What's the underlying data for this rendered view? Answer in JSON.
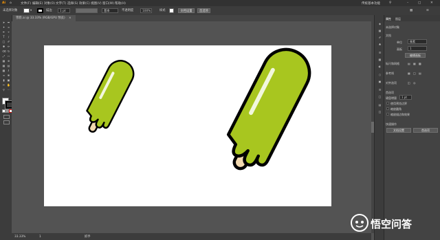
{
  "app": {
    "logo": "Ai",
    "home_icon": "home-icon",
    "accent": "#FF9A00",
    "window_title": "传统基本功能"
  },
  "menu": [
    "文件(F)",
    "编辑(E)",
    "对象(O)",
    "文字(T)",
    "选择(S)",
    "效果(C)",
    "视图(V)",
    "窗口(W)",
    "帮助(H)"
  ],
  "control": {
    "selection_label": "未选择对象",
    "stroke_value": "1 pt",
    "stroke_profile": "基本",
    "opacity_label": "不透明度",
    "opacity_value": "100%",
    "style_label": "样式",
    "doc_setup": "文档设置",
    "prefs": "首选项"
  },
  "document_tab": "雪糕.ai @ 33.33% (RGB/GPU 预览)",
  "status": {
    "zoom": "33.33%",
    "artboard": "1",
    "tool": "抓手"
  },
  "panel": {
    "tabs": [
      "属性",
      "图层"
    ],
    "section_doc": "未选择对象",
    "section_doc_label": "文档",
    "unit_label": "单位",
    "unit_value": "像素",
    "artboard_label": "画板",
    "artboard_value": "1",
    "edit_artboard": "编辑画板",
    "ruler_grid": "标尺和网格",
    "guides": "参考线",
    "align": "对齐选项",
    "prefs_header": "首选项",
    "keyboard_increment_label": "键盘增量",
    "keyboard_increment_value": "1 pt",
    "check1": "使用预览边界",
    "check2": "缩放圆角",
    "check3": "缩放描边和效果",
    "quick_actions": "快速操作",
    "btn_doc_setup": "文档设置",
    "btn_prefs": "首选项"
  },
  "watermark": {
    "logo_text": "悟空问答"
  },
  "artwork": {
    "popsicle_color": "#A8C61F",
    "stick_color": "#F2D9B0",
    "outline": "#000000"
  }
}
